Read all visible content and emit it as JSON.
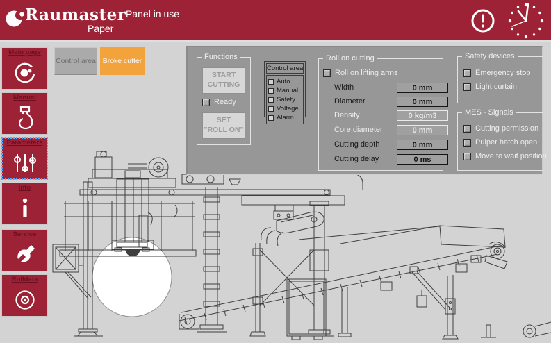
{
  "colors": {
    "brand_red": "#9d2235",
    "accent_orange": "#f2a33c",
    "panel_gray": "#979797"
  },
  "header": {
    "brand": "Raumaster",
    "brand_sub": "Paper",
    "status": "Panel in use"
  },
  "sidebar": {
    "items": [
      {
        "label": "Main page",
        "icon": "logo-roll-icon",
        "selected": false
      },
      {
        "label": "Manual",
        "icon": "pendant-control-icon",
        "selected": false
      },
      {
        "label": "Parameters",
        "icon": "sliders-icon",
        "selected": true
      },
      {
        "label": "Info",
        "icon": "info-icon",
        "selected": false
      },
      {
        "label": "Service",
        "icon": "wrench-icon",
        "selected": false
      },
      {
        "label": "Rolldata",
        "icon": "roll-end-icon",
        "selected": false
      }
    ]
  },
  "toolbar": {
    "buttons": [
      {
        "label": "Control area",
        "active": false
      },
      {
        "label": "Broke cutter",
        "active": true
      }
    ]
  },
  "functions_panel": {
    "title": "Functions",
    "start_button": {
      "line1": "START",
      "line2": "CUTTING"
    },
    "ready_checkbox": {
      "label": "Ready",
      "checked": false
    },
    "set_button": {
      "line1": "SET",
      "line2": "\"ROLL ON\""
    }
  },
  "control_area_panel": {
    "title": "Control area",
    "items": [
      {
        "label": "Auto",
        "checked": false
      },
      {
        "label": "Manual",
        "checked": false
      },
      {
        "label": "Safety",
        "checked": false
      },
      {
        "label": "Voltage",
        "checked": false
      },
      {
        "label": "Alarm",
        "checked": false
      }
    ]
  },
  "roll_on_cutting_panel": {
    "title": "Roll on cutting",
    "lifting_checkbox": {
      "label": "Roll on lifting arms",
      "checked": false
    },
    "rows": [
      {
        "label": "Width",
        "value": "0 mm",
        "disabled": false
      },
      {
        "label": "Diameter",
        "value": "0 mm",
        "disabled": false
      },
      {
        "label": "Density",
        "value": "0 kg/m3",
        "disabled": true
      },
      {
        "label": "Core diameter",
        "value": "0 mm",
        "disabled": true
      },
      {
        "label": "Cutting depth",
        "value": "0 mm",
        "disabled": false
      },
      {
        "label": "Cutting delay",
        "value": "0 ms",
        "disabled": false
      }
    ]
  },
  "safety_devices_panel": {
    "title": "Safety devices",
    "items": [
      {
        "label": "Emergency stop",
        "checked": false
      },
      {
        "label": "Light curtain",
        "checked": false
      }
    ]
  },
  "mes_signals_panel": {
    "title": "MES - Signals",
    "items": [
      {
        "label": "Cutting permission",
        "checked": false
      },
      {
        "label": "Pulper hatch open",
        "checked": false
      },
      {
        "label": "Move to wait position",
        "checked": false
      }
    ]
  }
}
